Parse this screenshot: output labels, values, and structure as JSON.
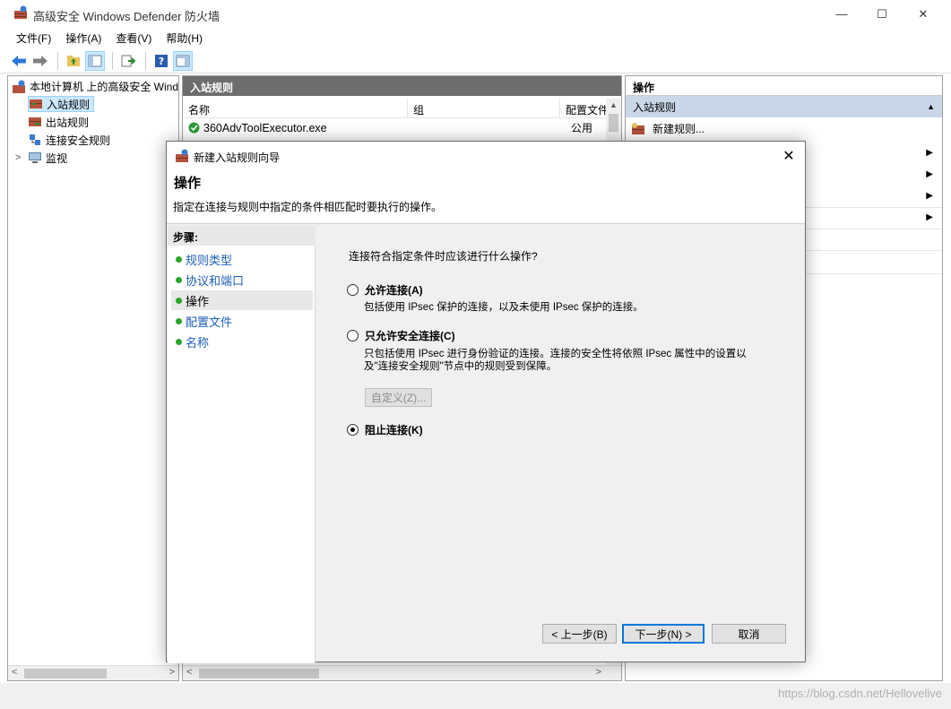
{
  "window": {
    "title": "高级安全 Windows Defender 防火墙",
    "controls": [
      "—",
      "☐",
      "✕"
    ]
  },
  "menu": [
    "文件(F)",
    "操作(A)",
    "查看(V)",
    "帮助(H)"
  ],
  "tree": {
    "root": "本地计算机 上的高级安全 Wind",
    "items": [
      "入站规则",
      "出站规则",
      "连接安全规则",
      "监视"
    ]
  },
  "list": {
    "header": "入站规则",
    "columns": [
      "名称",
      "组",
      "配置文件"
    ],
    "rows": [
      {
        "name": "360AdvToolExecutor.exe",
        "group": "",
        "profile": "公用"
      }
    ]
  },
  "actions": {
    "header": "操作",
    "section": "入站规则",
    "items": [
      "新建规则..."
    ]
  },
  "dialog": {
    "title": "新建入站规则向导",
    "heading": "操作",
    "description": "指定在连接与规则中指定的条件相匹配时要执行的操作。",
    "steps_title": "步骤:",
    "steps": [
      "规则类型",
      "协议和端口",
      "操作",
      "配置文件",
      "名称"
    ],
    "current_step": 2,
    "question": "连接符合指定条件时应该进行什么操作?",
    "options": [
      {
        "label": "允许连接(A)",
        "desc": "包括使用 IPsec 保护的连接，以及未使用 IPsec 保护的连接。",
        "checked": false
      },
      {
        "label": "只允许安全连接(C)",
        "desc1": "只包括使用 IPsec 进行身份验证的连接。连接的安全性将依照 IPsec 属性中的设置以",
        "desc2": "及\"连接安全规则\"节点中的规则受到保障。",
        "checked": false
      },
      {
        "label": "阻止连接(K)",
        "checked": true
      }
    ],
    "custom_label": "自定义(Z)...",
    "buttons": {
      "back": "< 上一步(B)",
      "next": "下一步(N) >",
      "cancel": "取消"
    }
  },
  "watermark": "https://blog.csdn.net/Hellovelive",
  "colors": {
    "pane_header": "#6d6d6d",
    "action_section": "#c9d7e8",
    "link": "#1e5eb6",
    "step_dot": "#2aa52a",
    "primary_border": "#0078d7"
  }
}
